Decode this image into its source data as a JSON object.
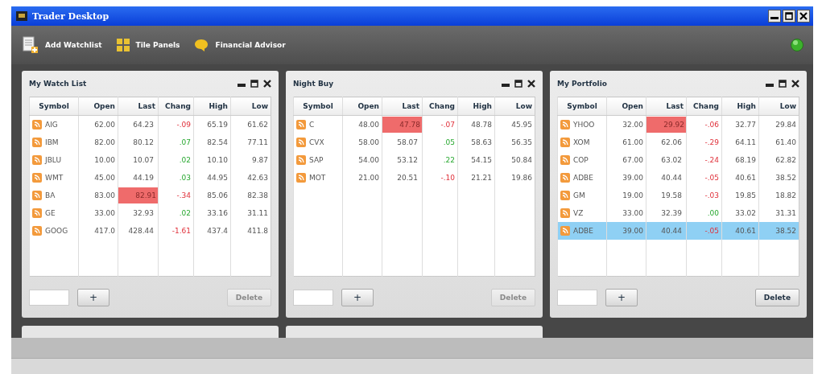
{
  "window": {
    "title": "Trader Desktop"
  },
  "toolbar": [
    {
      "label": "Add Watchlist",
      "kind": "add"
    },
    {
      "label": "Tile Panels",
      "kind": "tile"
    },
    {
      "label": "Financial Advisor",
      "kind": "advisor"
    }
  ],
  "panels": [
    {
      "title": "My Watch List",
      "columns": [
        "Symbol",
        "Open",
        "Last",
        "Chang",
        "High",
        "Low"
      ],
      "delete": {
        "label": "Delete",
        "disabled": true
      },
      "add": "+",
      "rows": [
        {
          "symbol": "AIG",
          "open": "62.00",
          "last": "64.23",
          "change": "-.09",
          "negative": true,
          "flash": false,
          "selected": false,
          "high": "65.19",
          "low": "61.62"
        },
        {
          "symbol": "IBM",
          "open": "82.00",
          "last": "80.12",
          "change": ".07",
          "negative": false,
          "flash": false,
          "selected": false,
          "high": "82.54",
          "low": "77.11"
        },
        {
          "symbol": "JBLU",
          "open": "10.00",
          "last": "10.07",
          "change": ".02",
          "negative": false,
          "flash": false,
          "selected": false,
          "high": "10.10",
          "low": "9.87"
        },
        {
          "symbol": "WMT",
          "open": "45.00",
          "last": "44.19",
          "change": ".03",
          "negative": false,
          "flash": false,
          "selected": false,
          "high": "44.95",
          "low": "42.63"
        },
        {
          "symbol": "BA",
          "open": "83.00",
          "last": "82.91",
          "change": "-.34",
          "negative": true,
          "flash": true,
          "selected": false,
          "high": "85.06",
          "low": "82.38"
        },
        {
          "symbol": "GE",
          "open": "33.00",
          "last": "32.93",
          "change": ".02",
          "negative": false,
          "flash": false,
          "selected": false,
          "high": "33.16",
          "low": "31.11"
        },
        {
          "symbol": "GOOG",
          "open": "417.0",
          "last": "428.44",
          "change": "-1.61",
          "negative": true,
          "flash": false,
          "selected": false,
          "high": "437.4",
          "low": "411.8"
        }
      ]
    },
    {
      "title": "Night Buy",
      "columns": [
        "Symbol",
        "Open",
        "Last",
        "Chang",
        "High",
        "Low"
      ],
      "delete": {
        "label": "Delete",
        "disabled": true
      },
      "add": "+",
      "rows": [
        {
          "symbol": "C",
          "open": "48.00",
          "last": "47.78",
          "change": "-.07",
          "negative": true,
          "flash": true,
          "selected": false,
          "high": "48.78",
          "low": "45.95"
        },
        {
          "symbol": "CVX",
          "open": "58.00",
          "last": "58.07",
          "change": ".05",
          "negative": false,
          "flash": false,
          "selected": false,
          "high": "58.63",
          "low": "56.35"
        },
        {
          "symbol": "SAP",
          "open": "54.00",
          "last": "53.12",
          "change": ".22",
          "negative": false,
          "flash": false,
          "selected": false,
          "high": "54.15",
          "low": "50.84"
        },
        {
          "symbol": "MOT",
          "open": "21.00",
          "last": "20.51",
          "change": "-.10",
          "negative": true,
          "flash": false,
          "selected": false,
          "high": "21.21",
          "low": "19.86"
        }
      ]
    },
    {
      "title": "My Portfolio",
      "columns": [
        "Symbol",
        "Open",
        "Last",
        "Chang",
        "High",
        "Low"
      ],
      "delete": {
        "label": "Delete",
        "disabled": false
      },
      "add": "+",
      "rows": [
        {
          "symbol": "YHOO",
          "open": "32.00",
          "last": "29.92",
          "change": "-.06",
          "negative": true,
          "flash": true,
          "selected": false,
          "high": "32.77",
          "low": "29.84"
        },
        {
          "symbol": "XOM",
          "open": "61.00",
          "last": "62.06",
          "change": "-.29",
          "negative": true,
          "flash": false,
          "selected": false,
          "high": "64.11",
          "low": "61.40"
        },
        {
          "symbol": "COP",
          "open": "67.00",
          "last": "63.02",
          "change": "-.24",
          "negative": true,
          "flash": false,
          "selected": false,
          "high": "68.19",
          "low": "62.82"
        },
        {
          "symbol": "ADBE",
          "open": "39.00",
          "last": "40.44",
          "change": "-.05",
          "negative": true,
          "flash": false,
          "selected": false,
          "high": "40.61",
          "low": "38.52"
        },
        {
          "symbol": "GM",
          "open": "19.00",
          "last": "19.58",
          "change": "-.03",
          "negative": true,
          "flash": false,
          "selected": false,
          "high": "19.85",
          "low": "18.82"
        },
        {
          "symbol": "VZ",
          "open": "33.00",
          "last": "32.39",
          "change": ".00",
          "negative": false,
          "flash": false,
          "selected": false,
          "high": "33.02",
          "low": "31.31"
        },
        {
          "symbol": "ADBE",
          "open": "39.00",
          "last": "40.44",
          "change": "-.05",
          "negative": true,
          "flash": false,
          "selected": true,
          "high": "40.61",
          "low": "38.52"
        }
      ]
    }
  ]
}
